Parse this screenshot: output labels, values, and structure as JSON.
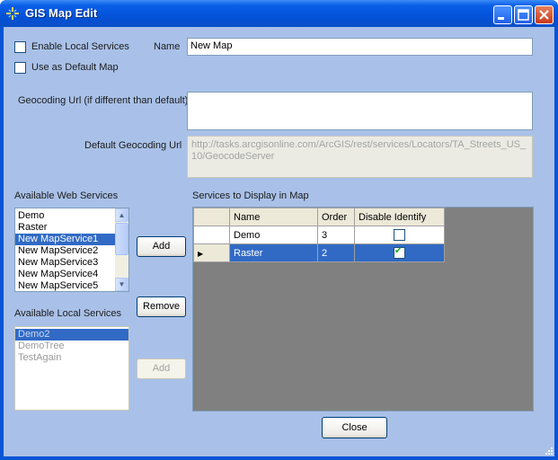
{
  "window": {
    "title": "GIS Map Edit"
  },
  "options": {
    "enable_local_services": "Enable Local Services",
    "use_as_default_map": "Use as Default Map"
  },
  "name": {
    "label": "Name",
    "value": "New Map"
  },
  "geocoding": {
    "label": "Geocoding Url (if different than default)",
    "value": "",
    "default_label": "Default Geocoding Url",
    "default_value": "http://tasks.arcgisonline.com/ArcGIS/rest/services/Locators/TA_Streets_US_10/GeocodeServer"
  },
  "web_services": {
    "label": "Available Web Services",
    "items": [
      "Demo",
      "Raster",
      "New MapService1",
      "New MapService2",
      "New MapService3",
      "New MapService4",
      "New MapService5"
    ],
    "selected": "New MapService1",
    "add_label": "Add",
    "remove_label": "Remove"
  },
  "local_services": {
    "label": "Available Local Services",
    "items": [
      "Demo2",
      "DemoTree",
      "TestAgain"
    ],
    "selected": "Demo2",
    "add_label": "Add"
  },
  "display_grid": {
    "label": "Services to Display in Map",
    "columns": [
      "Name",
      "Order",
      "Disable Identify"
    ],
    "rows": [
      {
        "name": "Demo",
        "order": "3",
        "disable_identify": false
      },
      {
        "name": "Raster",
        "order": "2",
        "disable_identify": true
      }
    ]
  },
  "footer": {
    "close_label": "Close"
  },
  "colors": {
    "titlebar": "#0a5fe8",
    "client": "#a9c1e8",
    "selection": "#316ac5"
  }
}
